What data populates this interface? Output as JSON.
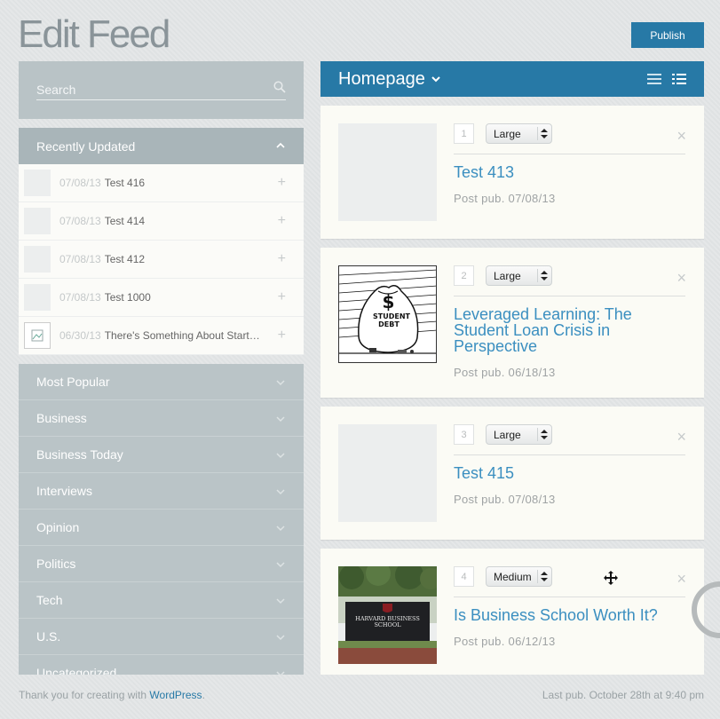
{
  "page": {
    "title": "Edit Feed",
    "publish_label": "Publish"
  },
  "search": {
    "placeholder": "Search"
  },
  "recent": {
    "title": "Recently Updated",
    "items": [
      {
        "date": "07/08/13",
        "title": "Test 416"
      },
      {
        "date": "07/08/13",
        "title": "Test 414"
      },
      {
        "date": "07/08/13",
        "title": "Test 412"
      },
      {
        "date": "07/08/13",
        "title": "Test 1000"
      },
      {
        "date": "06/30/13",
        "title": "There's Something About Start…"
      }
    ]
  },
  "categories": [
    "Most Popular",
    "Business",
    "Business Today",
    "Interviews",
    "Opinion",
    "Politics",
    "Tech",
    "U.S.",
    "Uncategorized"
  ],
  "feed": {
    "name": "Homepage",
    "cards": [
      {
        "num": "1",
        "size": "Large",
        "title": "Test 413",
        "meta": "Post pub. 07/08/13"
      },
      {
        "num": "2",
        "size": "Large",
        "title": "Leveraged Learning: The Student Loan Crisis in Perspective",
        "meta": "Post pub. 06/18/13"
      },
      {
        "num": "3",
        "size": "Large",
        "title": "Test 415",
        "meta": "Post pub. 07/08/13"
      },
      {
        "num": "4",
        "size": "Medium",
        "title": "Is Business School Worth It?",
        "meta": "Post pub. 06/12/13"
      }
    ],
    "images": {
      "student_debt_bag": "$",
      "student_debt_text": "STUDENT DEBT",
      "hbs_sign": "HARVARD BUSINESS SCHOOL"
    }
  },
  "footer": {
    "thanks": "Thank you for creating with",
    "wp_link": "WordPress",
    "period": ".",
    "last_pub": "Last pub. October 28th at 9:40 pm"
  },
  "colors": {
    "accent": "#2779a6",
    "link": "#3b8fc0",
    "sidebar": "#bac4c7"
  }
}
